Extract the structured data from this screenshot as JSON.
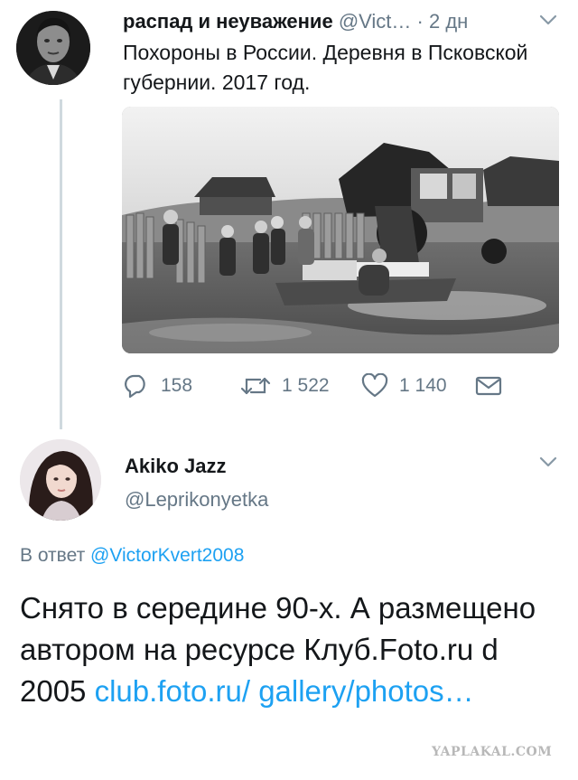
{
  "tweet1": {
    "author_name": "распад и неуважение",
    "handle": "@Vict…",
    "separator": "·",
    "time": "2 дн",
    "text": "Похороны в России. Деревня в Псковской губернии. 2017 год.",
    "avatar_icon": "man-portrait-avatar",
    "media_description_icon": "village-funeral-photo",
    "actions": {
      "replies": "158",
      "retweets": "1 522",
      "likes": "1 140"
    }
  },
  "tweet2": {
    "author_name": "Akiko Jazz",
    "handle": "@Leprikonyetka",
    "avatar_icon": "woman-portrait-avatar",
    "reply_prefix": "В ответ",
    "reply_mention": "@VictorKvert2008",
    "text": "Снято в середине 90-х. А размещено автором на ресурсе Клуб.Foto.ru d 2005 ",
    "link": "club.foto.ru/ gallery/photos…"
  },
  "watermark": "YAPLAKAL.COM",
  "colors": {
    "accent": "#1da1f2",
    "secondary_text": "#657786",
    "thread_line": "#cfd9de"
  }
}
